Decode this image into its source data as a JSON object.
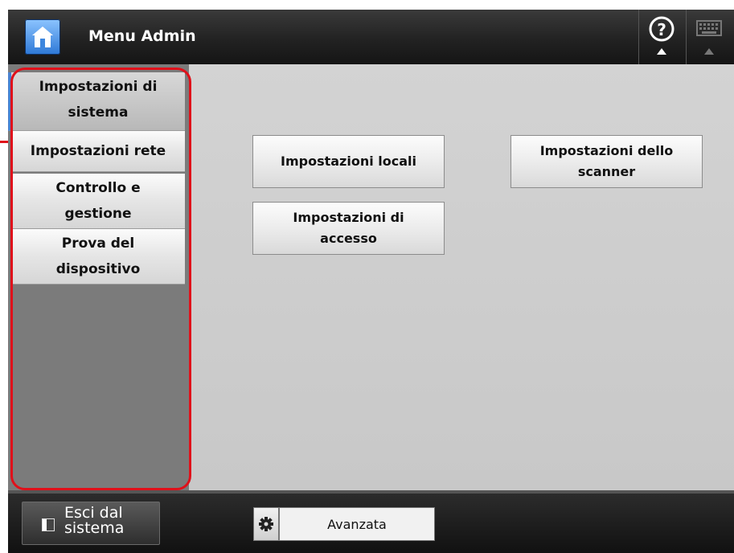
{
  "header": {
    "title": "Menu Admin"
  },
  "sidebar": {
    "items": [
      {
        "lines": [
          "Impostazioni di",
          "sistema"
        ],
        "active": true
      },
      {
        "lines": [
          "Impostazioni rete"
        ],
        "active": false
      },
      {
        "lines": [
          "Controllo e",
          "gestione"
        ],
        "active": false
      },
      {
        "lines": [
          "Prova del",
          "dispositivo"
        ],
        "active": false
      }
    ]
  },
  "main": {
    "buttons": {
      "local": "Impostazioni locali",
      "scanner": [
        "Impostazioni dello",
        "scanner"
      ],
      "access": [
        "Impostazioni di",
        "accesso"
      ]
    }
  },
  "footer": {
    "logout": [
      "Esci dal",
      "sistema"
    ],
    "advanced": "Avanzata"
  },
  "icons": [
    "home-icon",
    "help-icon",
    "keyboard-icon",
    "logout-icon",
    "gear-icon"
  ],
  "colors": {
    "highlight": "#e0101a",
    "accent": "#4a82d0"
  }
}
